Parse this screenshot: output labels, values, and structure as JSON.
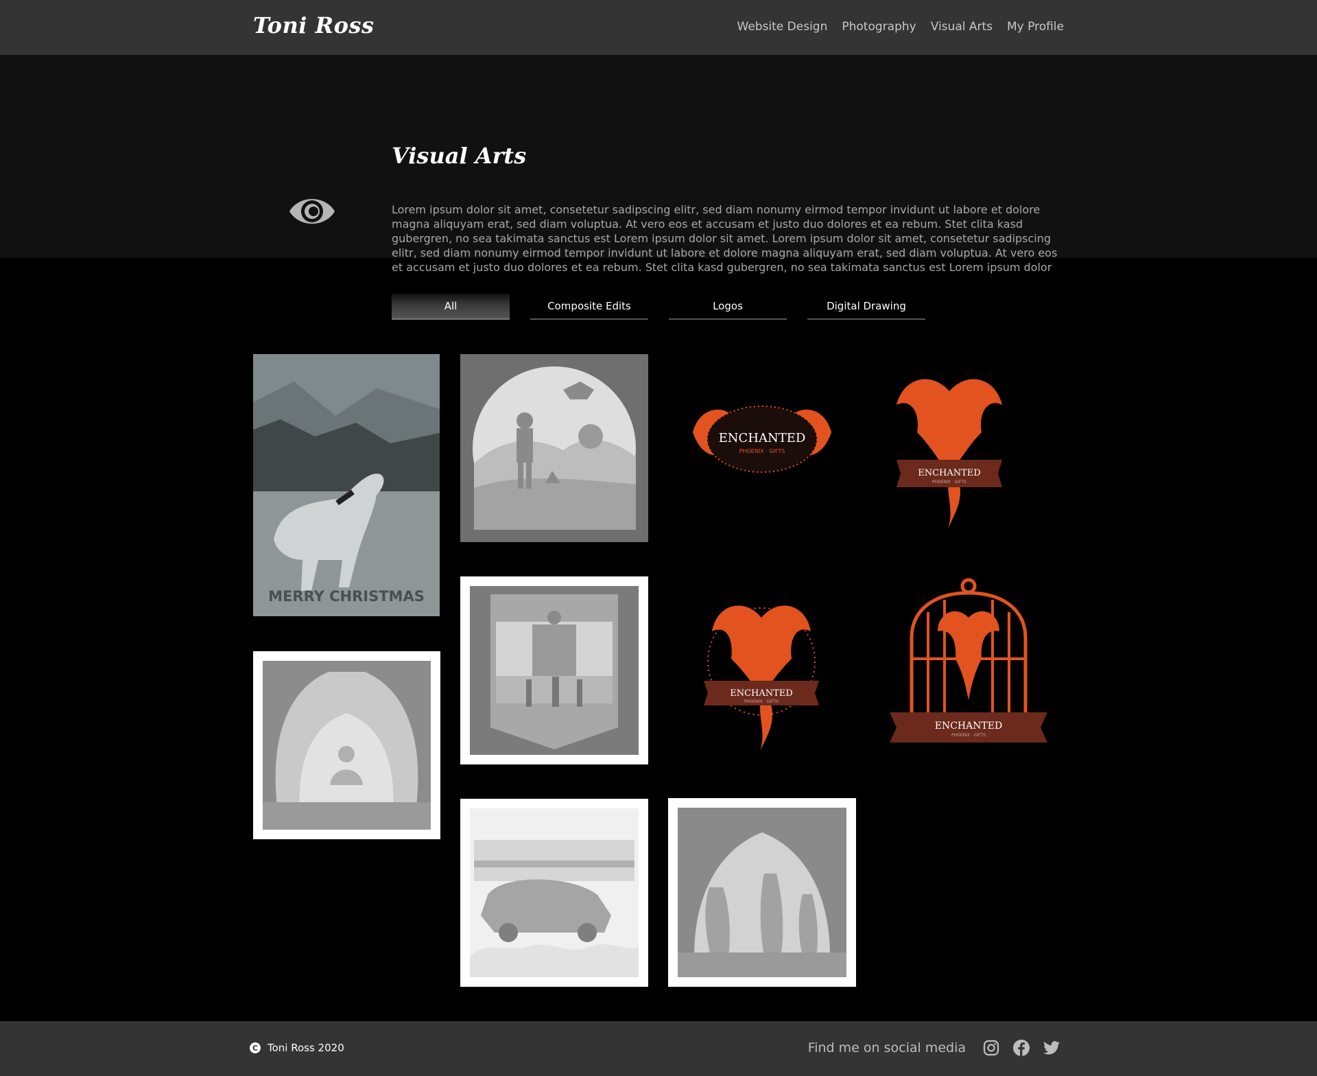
{
  "header": {
    "brand": "Toni Ross",
    "nav": [
      "Website Design",
      "Photography",
      "Visual Arts",
      "My Profile"
    ]
  },
  "intro": {
    "icon": "eye-icon",
    "title": "Visual Arts",
    "text": "Lorem ipsum dolor sit amet, consetetur sadipscing elitr, sed diam nonumy eirmod tempor invidunt ut labore et dolore magna aliquyam erat, sed diam voluptua. At vero eos et accusam et justo duo dolores et ea rebum. Stet clita kasd gubergren, no sea takimata sanctus est Lorem ipsum dolor sit amet. Lorem ipsum dolor sit amet, consetetur sadipscing elitr, sed diam nonumy eirmod tempor invidunt ut labore et dolore magna aliquyam erat, sed diam voluptua. At vero eos et accusam et justo duo dolores et ea rebum. Stet clita kasd gubergren, no sea takimata sanctus est Lorem ipsum dolor"
  },
  "filters": {
    "tabs": [
      "All",
      "Composite Edits",
      "Logos",
      "Digital Drawing"
    ],
    "active": "All"
  },
  "gallery": {
    "christmas_caption": "MERRY CHRISTMAS",
    "logo_word": "ENCHANTED",
    "logo_sub": "PHOENIX · GIFTS"
  },
  "footer": {
    "copyright": "Toni Ross 2020",
    "social_label": "Find me on social media",
    "icons": [
      "instagram-icon",
      "facebook-icon",
      "twitter-icon"
    ]
  },
  "colors": {
    "header_bg": "#343434",
    "intro_bg": "#111111",
    "page_bg": "#000000",
    "accent_orange": "#e2531f"
  }
}
